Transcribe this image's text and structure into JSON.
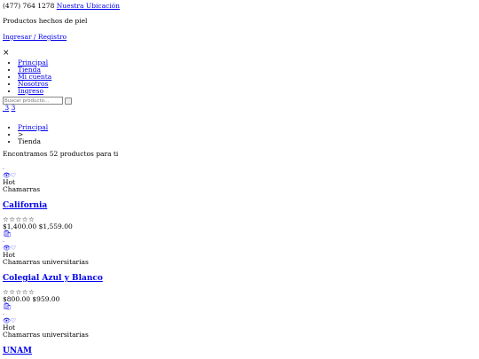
{
  "topbar": {
    "phone": "(477) 764 1278",
    "location_link": "Nuestra Ubicación"
  },
  "tagline": "Productos hechos de piel",
  "auth_link": "Ingresar / Registro",
  "close_symbol": "×",
  "menu": {
    "items": [
      {
        "label": "Principal"
      },
      {
        "label": "Tienda"
      },
      {
        "label": "Mi cuenta"
      },
      {
        "label": "Nosotros"
      },
      {
        "label": "Ingreso"
      }
    ]
  },
  "search": {
    "placeholder": "Buscar producto..."
  },
  "counters": {
    "a": "3",
    "b": "3"
  },
  "breadcrumb": {
    "home": "Principal",
    "separator": ">",
    "current": "Tienda"
  },
  "results_text": "Encontramos 52 productos para ti",
  "products": [
    {
      "badge": "Hot",
      "category": "Chamarras",
      "name": "California",
      "price": "$1,400.00",
      "old_price": "$1,559.00"
    },
    {
      "badge": "Hot",
      "category": "Chamarras universitarias",
      "name": "Colegial Azul y Blanco",
      "price": "$800.00",
      "old_price": "$959.00"
    },
    {
      "badge": "Hot",
      "category": "Chamarras universitarias",
      "name": "UNAM"
    }
  ],
  "icons": {
    "view": "eye-icon",
    "wishlist": "heart-icon",
    "cart": "cart-icon",
    "star": "star-icon"
  }
}
